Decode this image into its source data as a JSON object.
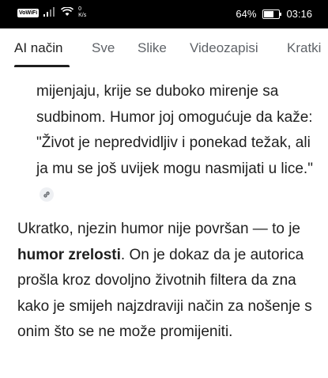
{
  "status_bar": {
    "volte_label": "VoWiFi",
    "speed_value": "0",
    "speed_unit": "K/s",
    "battery_percent": "64%",
    "battery_level": 0.64,
    "time": "03:16"
  },
  "tabs": [
    {
      "label": "AI način",
      "active": true
    },
    {
      "label": "Sve",
      "active": false
    },
    {
      "label": "Slike",
      "active": false
    },
    {
      "label": "Videozapisi",
      "active": false
    },
    {
      "label": "Kratki",
      "active": false
    }
  ],
  "quote": {
    "text": "mijenjaju, krije se duboko mirenje sa sudbinom. Humor joj omogućuje da kaže: \"Život je nepredvidljiv i ponekad težak, ali ja mu se još uvijek mogu nasmijati u lice.\"",
    "link_icon": "link-icon"
  },
  "summary": {
    "part1": "Ukratko, njezin humor nije površan — to je ",
    "bold": "humor zrelosti",
    "part2": ". On je dokaz da je autorica prošla kroz dovoljno životnih filtera da zna kako je smijeh najzdraviji način za nošenje s onim što se ne može promijeniti."
  }
}
